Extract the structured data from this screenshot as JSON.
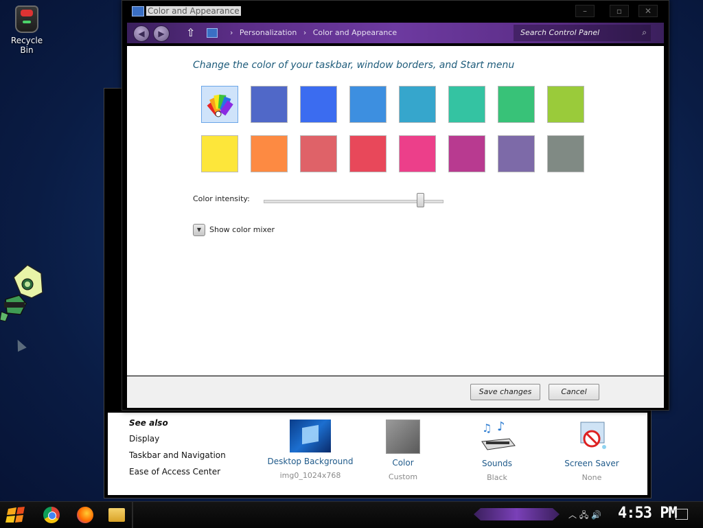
{
  "desktop": {
    "recycle_bin_label": "Recycle Bin"
  },
  "background_window": {
    "see_also_title": "See also",
    "see_also_links": [
      "Display",
      "Taskbar and Navigation",
      "Ease of Access Center"
    ],
    "tiles": [
      {
        "name": "Desktop Background",
        "sub": "img0_1024x768"
      },
      {
        "name": "Color",
        "sub": "Custom"
      },
      {
        "name": "Sounds",
        "sub": "Black"
      },
      {
        "name": "Screen Saver",
        "sub": "None"
      }
    ]
  },
  "main_window": {
    "title": "Color and Appearance",
    "controls": {
      "minimize": "–",
      "maximize": "▫",
      "close": "✕"
    },
    "address_bar": {
      "breadcrumbs": [
        "Personalization",
        "Color and Appearance"
      ],
      "separator": "›",
      "search_placeholder": "Search Control Panel"
    },
    "heading": "Change the color of your taskbar, window borders, and Start menu",
    "swatches": [
      {
        "color": "custom",
        "selected": true
      },
      {
        "color": "#5068c8"
      },
      {
        "color": "#3b6cf0"
      },
      {
        "color": "#3d8fe0"
      },
      {
        "color": "#36a6cc"
      },
      {
        "color": "#34c3a2"
      },
      {
        "color": "#38c278"
      },
      {
        "color": "#9acb3a"
      },
      {
        "color": "#fde63a"
      },
      {
        "color": "#fd8a42"
      },
      {
        "color": "#df6268"
      },
      {
        "color": "#e8485a"
      },
      {
        "color": "#ec3f8a"
      },
      {
        "color": "#b83a90"
      },
      {
        "color": "#7d6aa8"
      },
      {
        "color": "#808a84"
      }
    ],
    "intensity_label": "Color intensity:",
    "intensity_value": 0.87,
    "mixer_label": "Show color mixer",
    "save_label": "Save changes",
    "cancel_label": "Cancel"
  },
  "taskbar": {
    "clock": "4:53 PM",
    "apps": [
      "start-icon",
      "chrome-icon",
      "firefox-icon",
      "file-explorer-icon"
    ],
    "tray_icons": [
      "chevron-up-icon",
      "network-icon",
      "volume-icon",
      "notification-icon"
    ]
  }
}
